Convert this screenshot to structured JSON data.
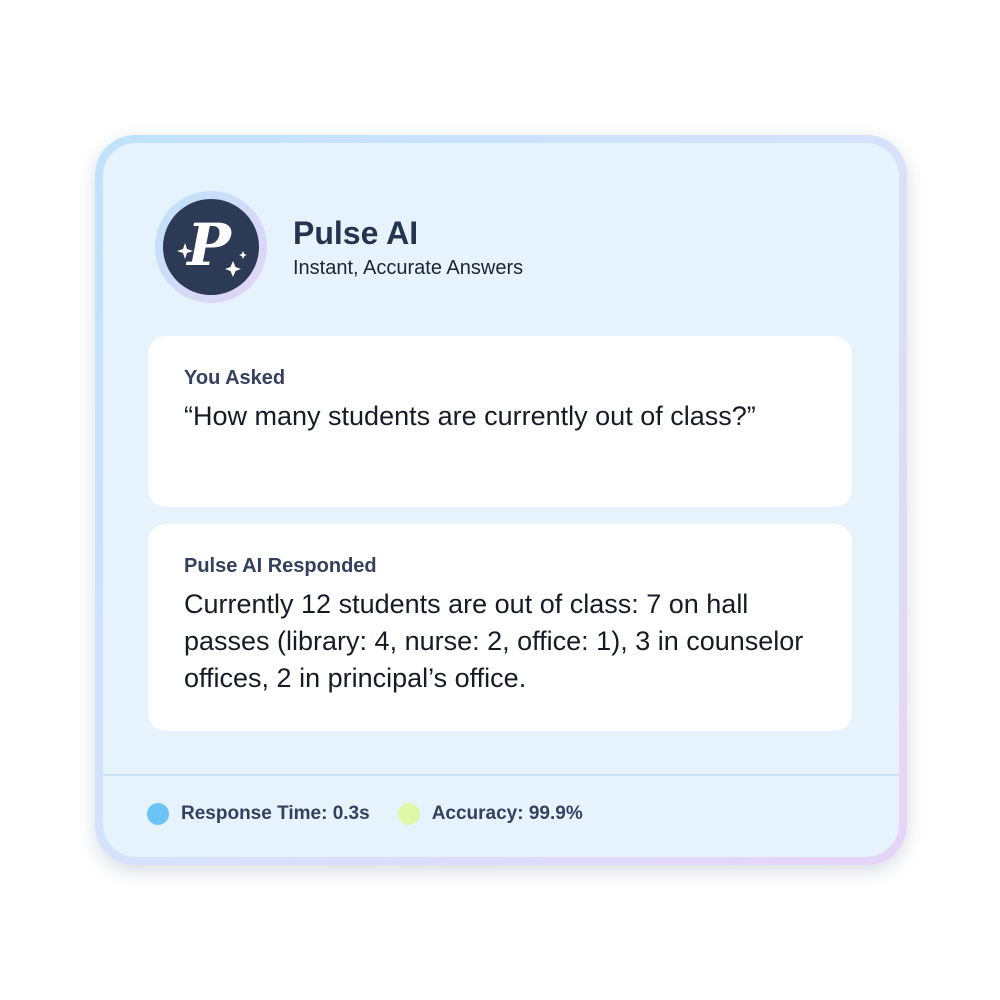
{
  "app": {
    "title": "Pulse AI",
    "subtitle": "Instant, Accurate Answers",
    "logo_letter": "P",
    "logo_icon": "sparkle-p-logo"
  },
  "question": {
    "label": "You Asked",
    "text": "“How many students are currently out of class?”"
  },
  "response": {
    "label": "Pulse AI Responded",
    "text": "Currently 12 students are out of class: 7 on hall passes (library: 4, nurse: 2, office: 1), 3 in counselor offices, 2 in principal’s office."
  },
  "stats": [
    {
      "label": "Response Time: 0.3s",
      "color": "#6cc3f5"
    },
    {
      "label": "Accuracy: 99.9%",
      "color": "#def7a8"
    }
  ],
  "colors": {
    "accent_dark": "#2d3a55",
    "card_background": "#e6f3fd",
    "border_gradient_start": "#bfe3fb",
    "border_gradient_end": "#e7d4f8"
  }
}
